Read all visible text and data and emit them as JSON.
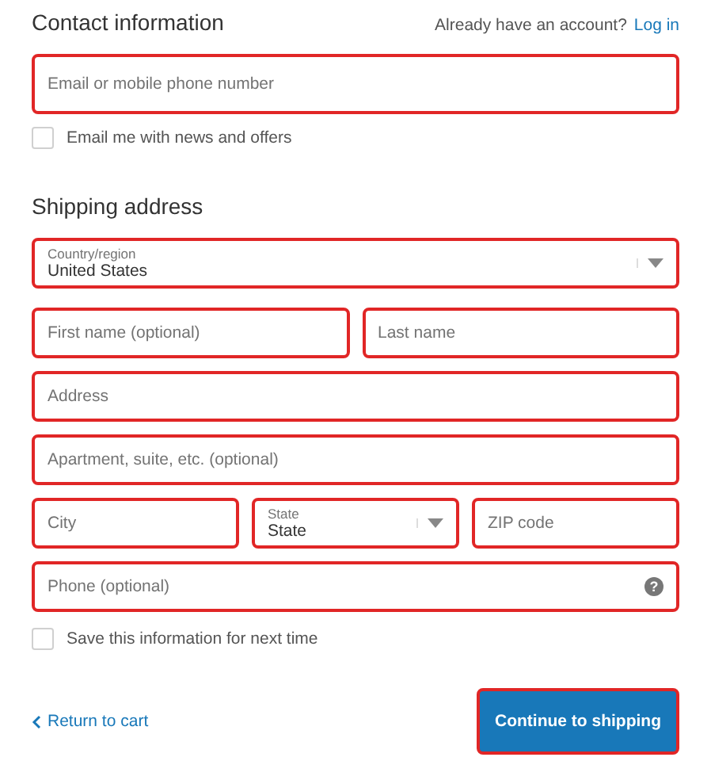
{
  "contact": {
    "title": "Contact information",
    "account_prompt": "Already have an account?",
    "login_link": "Log in",
    "email": {
      "placeholder": "Email or mobile phone number"
    },
    "news": {
      "label": "Email me with news and offers",
      "checked": false
    }
  },
  "shipping": {
    "title": "Shipping address",
    "rows": [
      [
        {
          "kind": "select",
          "label": "Country/region",
          "value": "United States"
        }
      ],
      [
        {
          "kind": "input",
          "placeholder": "First name (optional)"
        },
        {
          "kind": "input",
          "placeholder": "Last name"
        }
      ],
      [
        {
          "kind": "input",
          "placeholder": "Address"
        }
      ],
      [
        {
          "kind": "input",
          "placeholder": "Apartment, suite, etc. (optional)"
        }
      ],
      [
        {
          "kind": "input",
          "placeholder": "City"
        },
        {
          "kind": "select",
          "label": "State",
          "value": "State"
        },
        {
          "kind": "input",
          "placeholder": "ZIP code"
        }
      ],
      [
        {
          "kind": "help",
          "placeholder": "Phone (optional)",
          "icon": "?"
        }
      ]
    ],
    "save": {
      "label": "Save this information for next time",
      "checked": false
    }
  },
  "footer": {
    "back_link": "Return to cart",
    "continue_button": "Continue to shipping"
  }
}
